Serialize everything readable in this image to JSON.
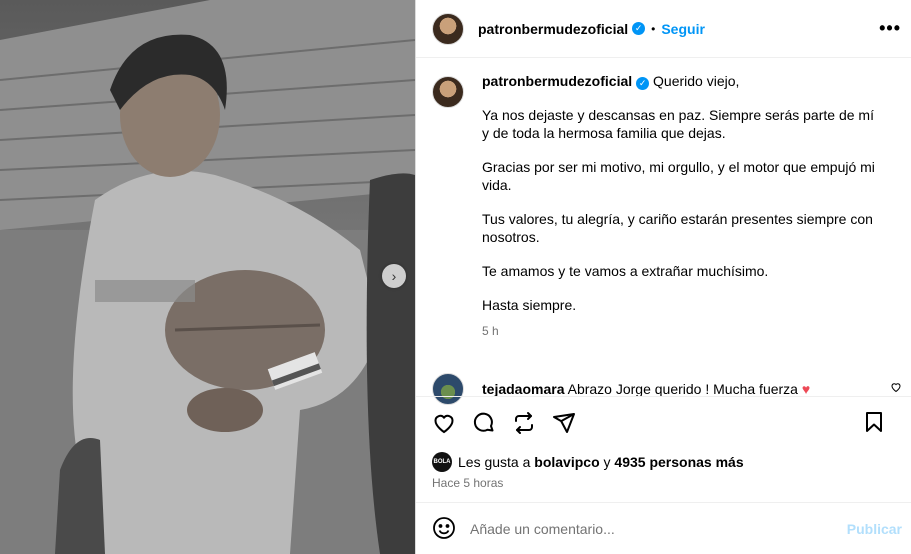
{
  "post": {
    "username": "patronbermudezoficial",
    "follow_label": "Seguir",
    "dot": "•",
    "more_label": "•••",
    "caption_first": "Querido viejo,",
    "paragraphs": [
      "Ya nos dejaste y descansas en paz. Siempre serás parte de mí y de toda la hermosa familia que dejas.",
      "Gracias por ser mi motivo, mi orgullo, y el motor que empujó mi vida.",
      "Tus valores, tu alegría, y cariño estarán presentes siempre con nosotros.",
      "Te amamos y te vamos a extrañar muchísimo.",
      "Hasta siempre."
    ],
    "caption_time": "5 h"
  },
  "comment": {
    "username": "tejadaomara",
    "text": "Abrazo Jorge querido ! Mucha fuerza",
    "emoji": "♥"
  },
  "likes": {
    "mini_avatar_text": "BOLA",
    "prefix": "Les gusta a",
    "liker": "bolavipco",
    "middle": "y",
    "count_text": "4935 personas más"
  },
  "posted_ago": "Hace 5 horas",
  "add_comment": {
    "placeholder": "Añade un comentario...",
    "publish_label": "Publicar"
  },
  "icons": {
    "like": "heart-icon",
    "comment": "comment-icon",
    "repost": "repost-icon",
    "share": "share-icon",
    "save": "bookmark-icon",
    "emoji": "emoji-icon",
    "verified": "verified-badge-icon",
    "next": "chevron-right-icon"
  },
  "colors": {
    "accent": "#0095f6",
    "muted": "#737373",
    "publish_disabled": "#b2dffc",
    "heart": "#ed4956"
  }
}
